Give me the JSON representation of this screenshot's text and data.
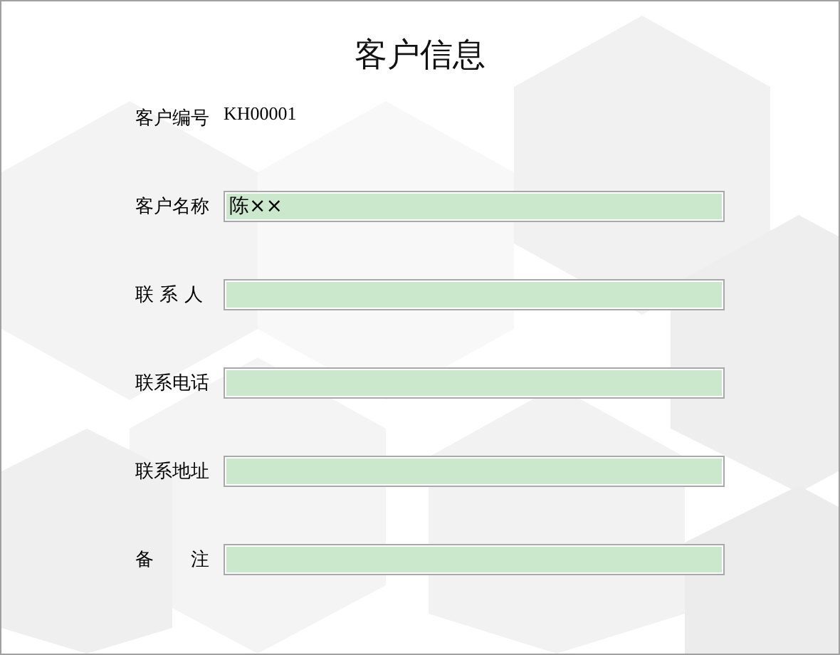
{
  "title": "客户信息",
  "fields": [
    {
      "kind": "text",
      "label": "客户编号",
      "value": "KH00001"
    },
    {
      "kind": "input",
      "label": "客户名称",
      "value": "陈××"
    },
    {
      "kind": "input",
      "label": "联 系 人"
    },
    {
      "kind": "input",
      "label": "联系电话"
    },
    {
      "kind": "input",
      "label": "联系地址"
    },
    {
      "kind": "input",
      "label": "备　　注"
    }
  ]
}
